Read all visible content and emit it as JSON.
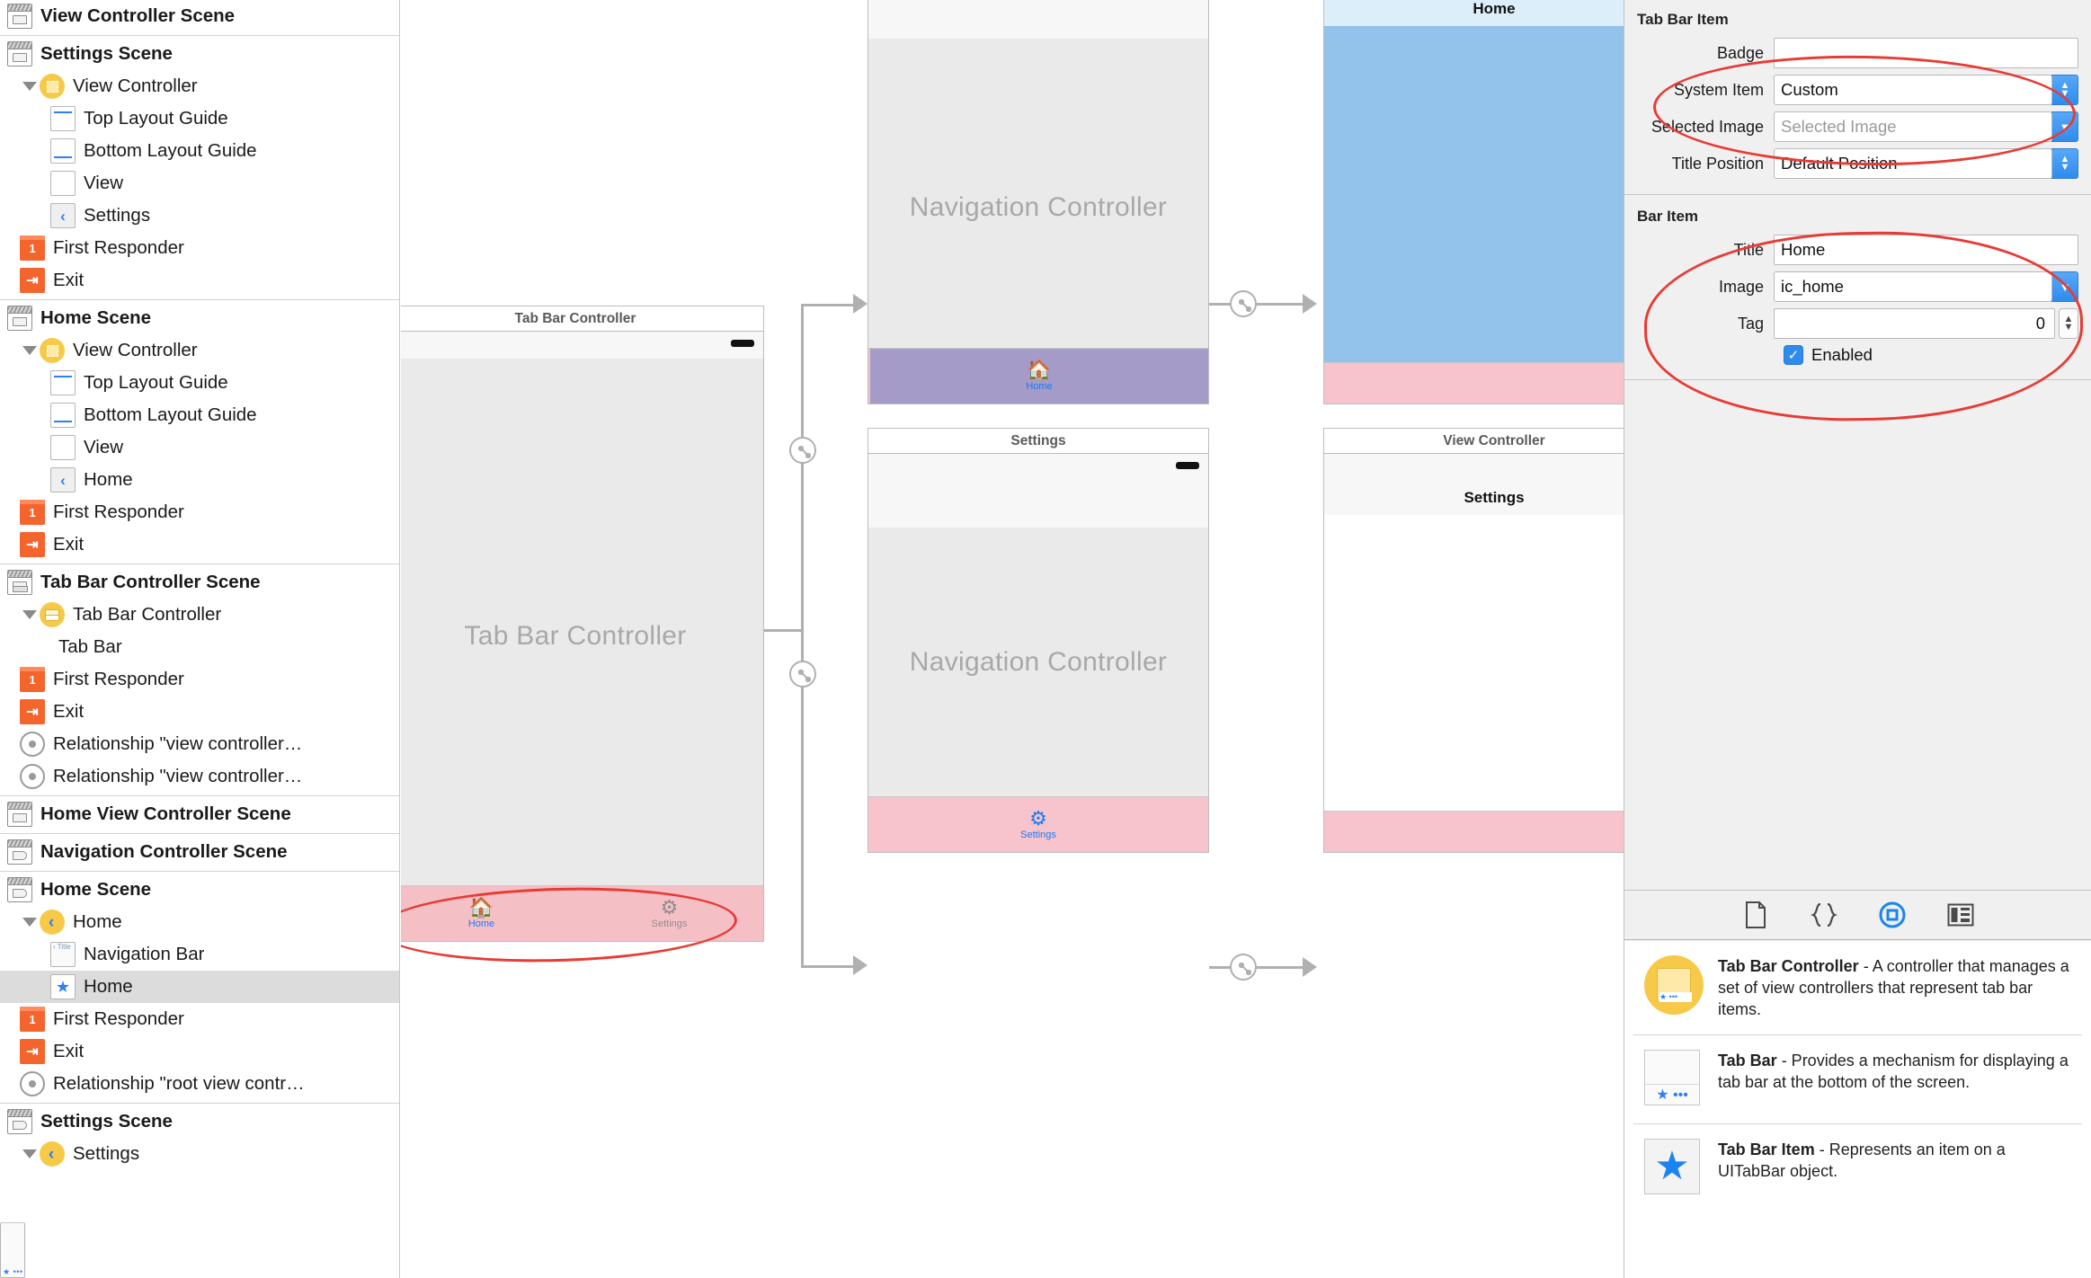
{
  "outline": {
    "groups": [
      {
        "scene": {
          "label": "View Controller Scene",
          "icon": "scene-icon"
        },
        "children": []
      },
      {
        "scene": {
          "label": "Settings Scene",
          "icon": "scene-icon"
        },
        "children": [
          {
            "label": "View Controller",
            "icon": "view-controller-icon",
            "indent": 0,
            "twisty": true
          },
          {
            "label": "Top Layout Guide",
            "icon": "top-layout-guide-icon",
            "indent": 1
          },
          {
            "label": "Bottom Layout Guide",
            "icon": "bottom-layout-guide-icon",
            "indent": 1
          },
          {
            "label": "View",
            "icon": "view-icon",
            "indent": 1
          },
          {
            "label": "Settings",
            "icon": "back-chevron-icon",
            "indent": 1
          },
          {
            "label": "First Responder",
            "icon": "first-responder-icon",
            "indent": 0
          },
          {
            "label": "Exit",
            "icon": "exit-icon",
            "indent": 0
          }
        ]
      },
      {
        "scene": {
          "label": "Home Scene",
          "icon": "scene-icon"
        },
        "children": [
          {
            "label": "View Controller",
            "icon": "view-controller-icon",
            "indent": 0,
            "twisty": true
          },
          {
            "label": "Top Layout Guide",
            "icon": "top-layout-guide-icon",
            "indent": 1
          },
          {
            "label": "Bottom Layout Guide",
            "icon": "bottom-layout-guide-icon",
            "indent": 1
          },
          {
            "label": "View",
            "icon": "view-icon",
            "indent": 1
          },
          {
            "label": "Home",
            "icon": "back-chevron-icon",
            "indent": 1
          },
          {
            "label": "First Responder",
            "icon": "first-responder-icon",
            "indent": 0
          },
          {
            "label": "Exit",
            "icon": "exit-icon",
            "indent": 0
          }
        ]
      },
      {
        "scene": {
          "label": "Tab Bar Controller Scene",
          "icon": "tab-scene-icon"
        },
        "children": [
          {
            "label": "Tab Bar Controller",
            "icon": "tab-bar-controller-icon",
            "indent": 0,
            "twisty": true
          },
          {
            "label": "Tab Bar",
            "icon": "tab-bar-icon",
            "indent": 1
          },
          {
            "label": "First Responder",
            "icon": "first-responder-icon",
            "indent": 0
          },
          {
            "label": "Exit",
            "icon": "exit-icon",
            "indent": 0
          },
          {
            "label": "Relationship \"view controller…",
            "icon": "relationship-icon",
            "indent": 0
          },
          {
            "label": "Relationship \"view controller…",
            "icon": "relationship-icon",
            "indent": 0
          }
        ]
      },
      {
        "scene": {
          "label": "Home View Controller Scene",
          "icon": "scene-icon"
        },
        "children": []
      },
      {
        "scene": {
          "label": "Navigation Controller Scene",
          "icon": "nav-scene-icon"
        },
        "children": []
      },
      {
        "scene": {
          "label": "Home Scene",
          "icon": "nav-scene-icon"
        },
        "children": [
          {
            "label": "Home",
            "icon": "nav-controller-icon",
            "indent": 0,
            "twisty": true
          },
          {
            "label": "Navigation Bar",
            "icon": "navigation-bar-icon",
            "indent": 1
          },
          {
            "label": "Home",
            "icon": "tab-bar-item-icon",
            "indent": 1,
            "selected": true
          },
          {
            "label": "First Responder",
            "icon": "first-responder-icon",
            "indent": 0
          },
          {
            "label": "Exit",
            "icon": "exit-icon",
            "indent": 0
          },
          {
            "label": "Relationship \"root view contr…",
            "icon": "relationship-icon",
            "indent": 0
          }
        ]
      },
      {
        "scene": {
          "label": "Settings Scene",
          "icon": "nav-scene-icon"
        },
        "children": [
          {
            "label": "Settings",
            "icon": "nav-controller-icon",
            "indent": 0,
            "twisty": true
          }
        ]
      }
    ]
  },
  "canvas": {
    "scenes": {
      "tab_bar_controller": {
        "title": "Tab Bar Controller",
        "body_label": "Tab Bar Controller",
        "tabs": [
          {
            "label": "Home",
            "icon": "home-icon",
            "selected": true
          },
          {
            "label": "Settings",
            "icon": "gear-icon",
            "selected": false
          }
        ],
        "tabbar_color": "#f5bfc6"
      },
      "nav_home": {
        "body_label": "Navigation Controller",
        "tabs": [
          {
            "label": "Home",
            "icon": "home-icon",
            "selected": true
          }
        ],
        "tabbar_color": "#a49bc8"
      },
      "home": {
        "nav_title": "Home",
        "navbar_color": "#dceefa",
        "body_color": "#93c2ea",
        "tabbar_color": "#f7c3cd"
      },
      "nav_settings": {
        "title": "Settings",
        "body_label": "Navigation Controller",
        "tabs": [
          {
            "label": "Settings",
            "icon": "gear-icon",
            "selected": true
          }
        ],
        "tabbar_color": "#f7c3cd"
      },
      "settings_vc": {
        "title": "View Controller",
        "nav_title": "Settings",
        "body_color": "#ffffff",
        "tabbar_color": "#f7c3cd"
      }
    }
  },
  "inspector": {
    "tab_bar_item": {
      "heading": "Tab Bar Item",
      "fields": [
        {
          "label": "Badge",
          "type": "text",
          "value": "",
          "placeholder": ""
        },
        {
          "label": "System Item",
          "type": "popup",
          "value": "Custom"
        },
        {
          "label": "Selected Image",
          "type": "combo",
          "value": "",
          "placeholder": "Selected Image"
        },
        {
          "label": "Title Position",
          "type": "popup",
          "value": "Default Position"
        }
      ]
    },
    "bar_item": {
      "heading": "Bar Item",
      "fields": [
        {
          "label": "Title",
          "type": "text",
          "value": "Home"
        },
        {
          "label": "Image",
          "type": "combo",
          "value": "ic_home"
        },
        {
          "label": "Tag",
          "type": "step",
          "value": "0"
        }
      ],
      "checkbox": {
        "label": "Enabled",
        "checked": true
      }
    },
    "library_tabs": [
      {
        "icon": "file-template-icon",
        "selected": false
      },
      {
        "icon": "code-snippet-icon",
        "selected": false
      },
      {
        "icon": "object-library-icon",
        "selected": true
      },
      {
        "icon": "media-library-icon",
        "selected": false
      }
    ],
    "library_items": [
      {
        "icon": "tab-bar-controller-thumb",
        "title": "Tab Bar Controller",
        "desc": " - A controller that manages a set of view controllers that represent tab bar items."
      },
      {
        "icon": "tab-bar-thumb",
        "title": "Tab Bar",
        "desc": " - Provides a mechanism for displaying a tab bar at the bottom of the screen."
      },
      {
        "icon": "tab-bar-item-thumb",
        "title": "Tab Bar Item",
        "desc": " - Represents an item on a UITabBar object."
      }
    ]
  },
  "colors": {
    "accent": "#1a84f0",
    "annotation": "#e83b34",
    "selection": "#dcdcdc"
  }
}
